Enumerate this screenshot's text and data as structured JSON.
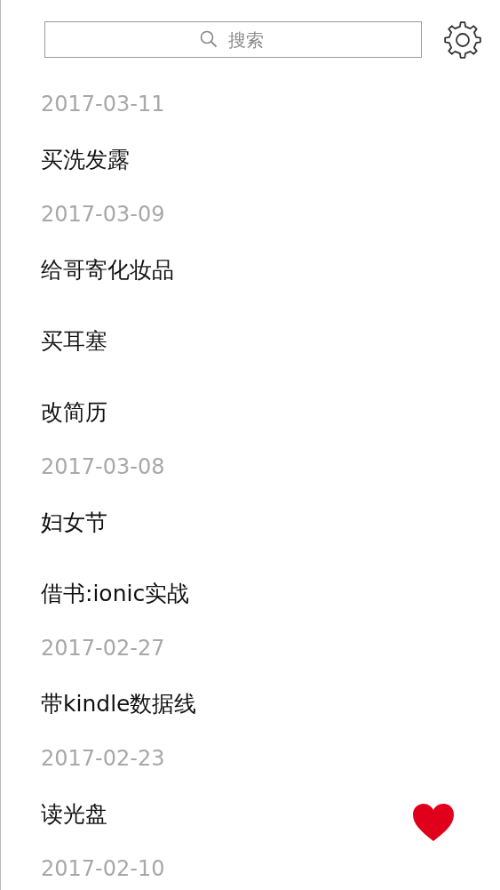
{
  "search": {
    "placeholder": "搜索"
  },
  "groups": [
    {
      "date": "2017-03-11",
      "items": [
        {
          "title": "买洗发露"
        }
      ]
    },
    {
      "date": "2017-03-09",
      "items": [
        {
          "title": "给哥寄化妆品"
        },
        {
          "title": "买耳塞"
        },
        {
          "title": "改简历"
        }
      ]
    },
    {
      "date": "2017-03-08",
      "items": [
        {
          "title": "妇女节"
        },
        {
          "title": "借书:ionic实战"
        }
      ]
    },
    {
      "date": "2017-02-27",
      "items": [
        {
          "title": "带kindle数据线"
        }
      ]
    },
    {
      "date": "2017-02-23",
      "items": [
        {
          "title": "读光盘"
        }
      ]
    },
    {
      "date": "2017-02-10"
    }
  ]
}
